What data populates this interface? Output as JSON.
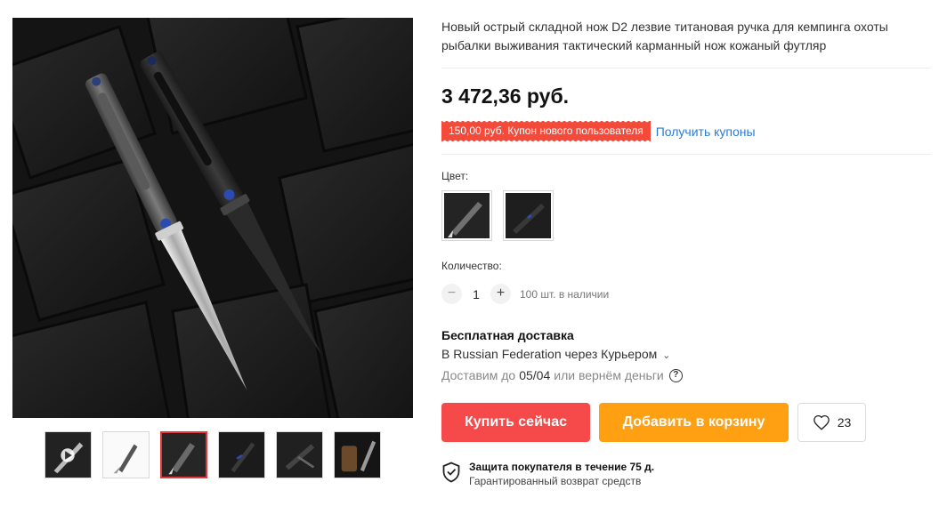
{
  "product": {
    "title": "Новый острый складной нож D2 лезвие титановая ручка для кемпинга охоты рыбалки выживания тактический карманный нож кожаный футляр",
    "price": "3 472,36 руб.",
    "image_alt": "Складной нож D2"
  },
  "coupon": {
    "text": "150,00 руб. Купон нового пользователя",
    "link": "Получить купоны"
  },
  "color": {
    "label": "Цвет:",
    "options": [
      "silver-knife",
      "black-knife"
    ]
  },
  "quantity": {
    "label": "Количество:",
    "value": "1",
    "minus": "−",
    "plus": "+",
    "stock": "100 шт. в наличии"
  },
  "shipping": {
    "title": "Бесплатная доставка",
    "method": "В Russian Federation через Курьером",
    "chevron": "⌄",
    "deliver_prefix": "Доставим до",
    "deliver_date": "05/04",
    "deliver_suffix": "или вернём деньги",
    "help": "?"
  },
  "actions": {
    "buy_now": "Купить сейчас",
    "add_to_cart": "Добавить в корзину",
    "wishlist_count": "23"
  },
  "protection": {
    "title": "Защита покупателя в течение 75 д.",
    "subtitle": "Гарантированный возврат средств"
  },
  "thumbnails": [
    "video-thumb",
    "silver-knife-white-bg",
    "silver-knife-dark",
    "black-knife-dark",
    "black-knife-open",
    "knife-with-sheath"
  ],
  "colors": {
    "accent_red": "#f64a4a",
    "accent_orange": "#ff9f12",
    "link_blue": "#2b7bd5"
  }
}
